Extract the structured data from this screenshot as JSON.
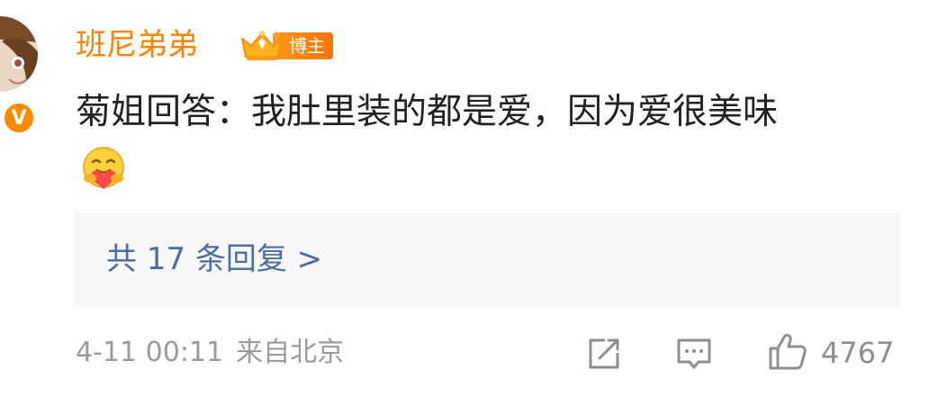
{
  "comment": {
    "username": "班尼弟弟",
    "host_badge": "博主",
    "verified_mark": "V",
    "text": "菊姐回答：我肚里装的都是爱，因为爱很美味",
    "emoji_icon": "hug-emoji-icon",
    "replies_link": "共 17 条回复 >",
    "time": "4-11 00:11",
    "location": "来自北京",
    "like_count": "4767"
  },
  "icons": {
    "share": "share-icon",
    "comment": "comment-icon",
    "like": "thumbs-up-icon"
  },
  "colors": {
    "username": "#ff8200",
    "host_badge": "#ff8200",
    "verified_badge": "#ff8a00",
    "link": "#4a6fa5",
    "meta": "#9b9b9b",
    "text": "#222222",
    "reply_bg": "#f7f7f7"
  }
}
